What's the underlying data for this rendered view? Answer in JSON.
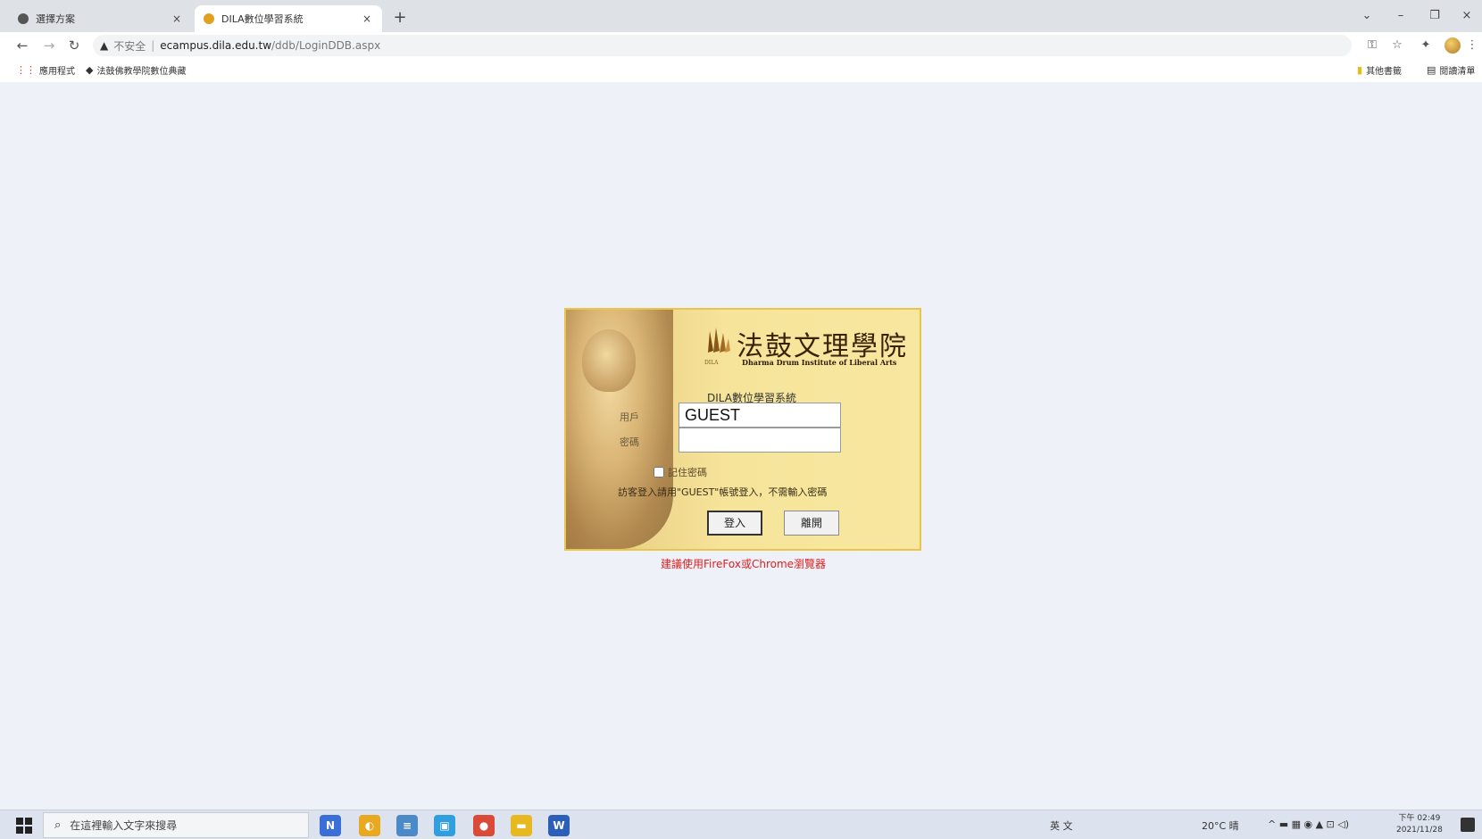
{
  "browser": {
    "tabs": [
      {
        "title": "選擇方案",
        "close": "×",
        "favicon_color": "#555555"
      },
      {
        "title": "DILA數位學習系統",
        "close": "×",
        "favicon_color": "#e0a020"
      }
    ],
    "new_tab": "+",
    "window_controls": {
      "menu": "⌄",
      "minimize": "–",
      "restore": "❐",
      "close": "×"
    },
    "nav": {
      "back": "←",
      "forward": "→",
      "reload": "↻"
    },
    "address": {
      "warning_icon": "▲",
      "security_label": "不安全",
      "separator": "|",
      "host": "ecampus.dila.edu.tw",
      "path": "/ddb/LoginDDB.aspx"
    },
    "toolbar_icons": {
      "key": "⚿",
      "star": "☆",
      "extensions": "✦",
      "menu": "⋮"
    },
    "bookmarks": [
      {
        "icon": "⋮⋮",
        "label": "應用程式"
      },
      {
        "icon": "◆",
        "label": "法鼓佛教學院數位典藏"
      }
    ],
    "bookmarks_right": [
      {
        "icon": "▮",
        "label": "其他書籤"
      },
      {
        "icon": "▤",
        "label": "閱讀清單"
      }
    ]
  },
  "login": {
    "logo_cn": "法鼓文理學院",
    "logo_en": "Dharma Drum Institute of Liberal Arts",
    "logo_sub": "DILA",
    "system_title": "DILA數位學習系統",
    "user_label": "用戶",
    "user_value": "GUEST",
    "password_label": "密碼",
    "password_value": "",
    "remember_label": "記住密碼",
    "remember_checked": false,
    "hint": "訪客登入請用\"GUEST\"帳號登入，不需輸入密碼",
    "login_button": "登入",
    "leave_button": "離開",
    "browser_note": "建議使用FireFox或Chrome瀏覽器"
  },
  "taskbar": {
    "search_placeholder": "在這裡輸入文字來搜尋",
    "apps": [
      {
        "label": "N",
        "color": "#3a6fd8"
      },
      {
        "label": "◐",
        "color": "#e8a820"
      },
      {
        "label": "≡",
        "color": "#4a8ac8"
      },
      {
        "label": "▣",
        "color": "#2f9fe0"
      },
      {
        "label": "●",
        "color": "#d94a38"
      },
      {
        "label": "▬",
        "color": "#e8b820"
      },
      {
        "label": "W",
        "color": "#2b5fb8"
      }
    ],
    "ime": "英 ⽂",
    "weather": "20°C 晴",
    "tray_icons": "^ ▬ ▦ ◉ ▲ ⊡ ◁)",
    "time": "下午 02:49",
    "date": "2021/11/28"
  }
}
